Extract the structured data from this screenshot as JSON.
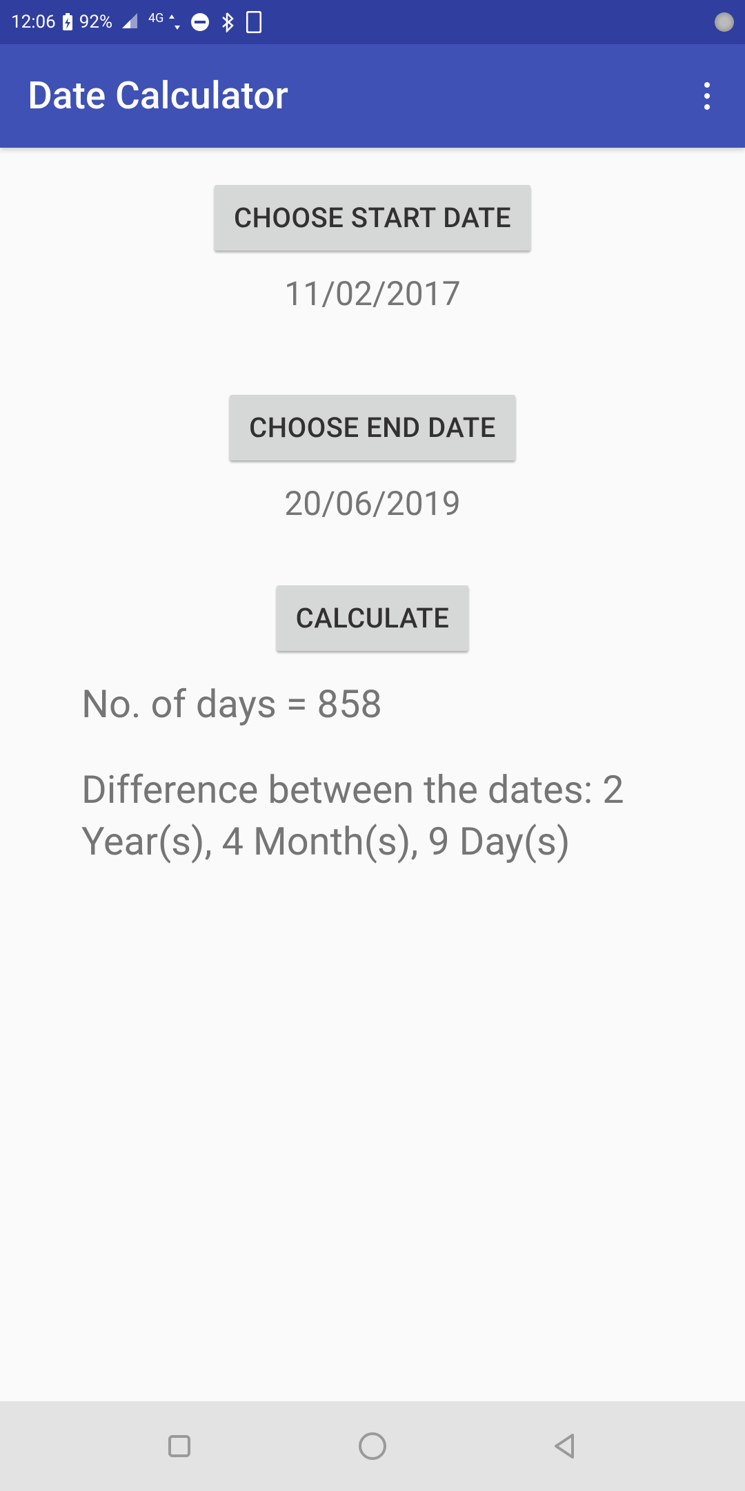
{
  "status": {
    "time": "12:06",
    "battery_pct": "92%",
    "network": "4G"
  },
  "header": {
    "title": "Date Calculator"
  },
  "main": {
    "start_button": "CHOOSE START DATE",
    "start_date": "11/02/2017",
    "end_button": "CHOOSE END DATE",
    "end_date": "20/06/2019",
    "calc_button": "CALCULATE",
    "days_result": "No. of days = 858",
    "diff_result": "Difference between the dates: 2 Year(s), 4 Month(s), 9 Day(s)"
  }
}
